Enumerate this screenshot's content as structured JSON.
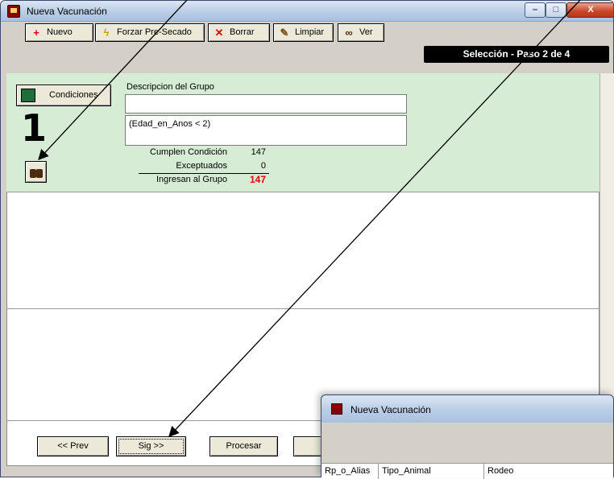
{
  "window": {
    "title": "Nueva Vacunación",
    "min_label": "–",
    "max_label": "□",
    "close_label": "X"
  },
  "toolbar": {
    "nuevo": "Nuevo",
    "forzar": "Forzar Pre-Secado",
    "borrar": "Borrar",
    "limpiar": "Limpiar",
    "ver": "Ver"
  },
  "step_banner": "Selección  - Paso 2 de 4",
  "group": {
    "condiciones_button": "Condiciones",
    "number": "1",
    "desc_label": "Descripcion del Grupo",
    "desc_value": "",
    "condition": "(Edad_en_Anos < 2)",
    "stats": {
      "cumplen_label": "Cumplen Condición",
      "cumplen_value": "147",
      "exceptuados_label": "Exceptuados",
      "exceptuados_value": "0",
      "ingresan_label": "Ingresan al Grupo",
      "ingresan_value": "147"
    }
  },
  "nav": {
    "prev": "<< Prev",
    "sig": "Sig >>",
    "procesar": "Procesar"
  },
  "popup": {
    "title": "Nueva Vacunación",
    "columns": [
      "Rp_o_Alias",
      "Tipo_Animal",
      "Rodeo"
    ]
  },
  "colors": {
    "group_bg": "#d6ecd4",
    "total": "#e00000",
    "banner": "#000000"
  }
}
